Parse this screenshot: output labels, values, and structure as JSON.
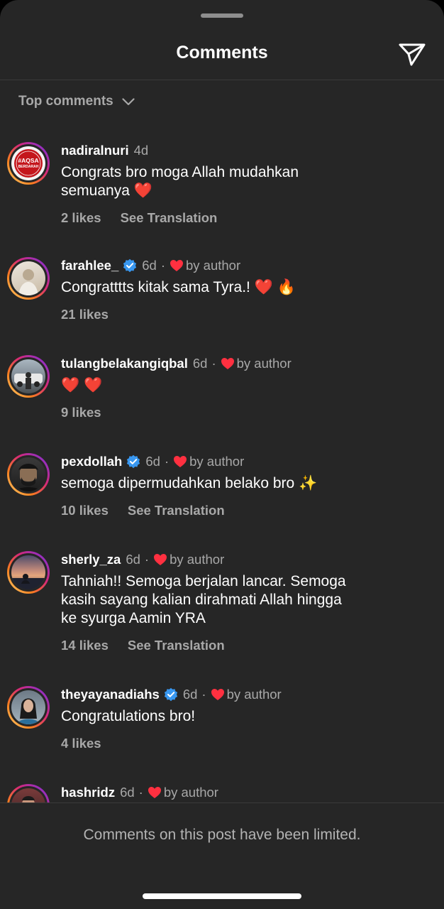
{
  "header": {
    "title": "Comments",
    "send_icon": "paper-plane-icon"
  },
  "sort": {
    "label": "Top comments",
    "icon": "chevron-down-icon"
  },
  "comments": [
    {
      "username": "nadiralnuri",
      "verified": false,
      "time": "4d",
      "liked_by_author": false,
      "by_author_label": "",
      "text": "Congrats bro moga Allah mudahkan\nsemuanya ❤️",
      "likes": "2 likes",
      "translate": "See Translation"
    },
    {
      "username": "farahlee_",
      "verified": true,
      "time": "6d",
      "liked_by_author": true,
      "by_author_label": "by author",
      "text": "Congratttts kitak sama Tyra.! ❤️ 🔥",
      "likes": "21 likes",
      "translate": ""
    },
    {
      "username": "tulangbelakangiqbal",
      "verified": false,
      "time": "6d",
      "liked_by_author": true,
      "by_author_label": "by author",
      "text": "❤️ ❤️",
      "likes": "9 likes",
      "translate": ""
    },
    {
      "username": "pexdollah",
      "verified": true,
      "time": "6d",
      "liked_by_author": true,
      "by_author_label": "by author",
      "text": "semoga dipermudahkan belako bro ✨",
      "likes": "10 likes",
      "translate": "See Translation"
    },
    {
      "username": "sherly_za",
      "verified": false,
      "time": "6d",
      "liked_by_author": true,
      "by_author_label": "by author",
      "text": "Tahniah!! Semoga berjalan lancar.  Semoga\nkasih sayang kalian dirahmati Allah hingga\nke syurga Aamin YRA",
      "likes": "14 likes",
      "translate": "See Translation"
    },
    {
      "username": "theyayanadiahs",
      "verified": true,
      "time": "6d",
      "liked_by_author": true,
      "by_author_label": "by author",
      "text": "Congratulations bro!",
      "likes": "4 likes",
      "translate": ""
    },
    {
      "username": "hashridz",
      "verified": false,
      "time": "6d",
      "liked_by_author": true,
      "by_author_label": "by author",
      "text": "",
      "likes": "",
      "translate": ""
    }
  ],
  "avatar_1_badge": [
    "#AQSA",
    "BERDARAH"
  ],
  "footer": {
    "notice": "Comments on this post have been limited."
  },
  "colors": {
    "background": "#262626",
    "secondary_text": "#a8a8a8",
    "verified_blue": "#3897f0",
    "heart_red": "#ff3040"
  }
}
